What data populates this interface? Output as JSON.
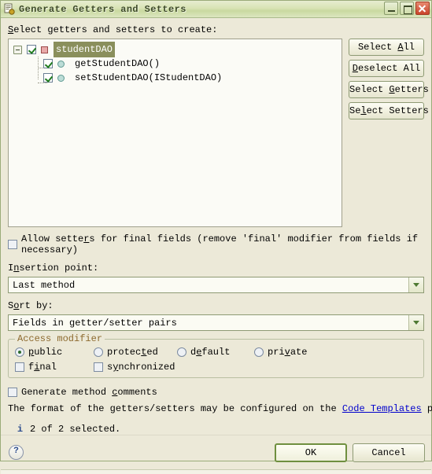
{
  "window": {
    "title": "Generate Getters and Setters",
    "app_icon": "generate-getters-setters-icon",
    "minimize_label": "Minimize",
    "maximize_label": "Maximize",
    "close_label": "Close"
  },
  "tree_section": {
    "label": "Select getters and setters to create:",
    "nodes": [
      {
        "label": "studentDAO",
        "icon": "field-icon",
        "checked": true,
        "selected": true,
        "expanded": true
      },
      {
        "label": "getStudentDAO()",
        "icon": "method-icon",
        "checked": true,
        "selected": false
      },
      {
        "label": "setStudentDAO(IStudentDAO)",
        "icon": "method-icon",
        "checked": true,
        "selected": false
      }
    ]
  },
  "side_buttons": [
    {
      "label": "Select All",
      "mnemonic_index": 7
    },
    {
      "label": "Deselect All",
      "mnemonic_index": 0
    },
    {
      "label": "Select Getters",
      "mnemonic_index": 7
    },
    {
      "label": "Select Setters",
      "mnemonic_index": 2
    }
  ],
  "allow_setters": {
    "label_pre": "Allow sette",
    "label_mnemonic": "r",
    "label_post": "s for final fields (remove 'final' modifier from fields if necessary)",
    "checked": false
  },
  "insertion_point": {
    "label_pre": "I",
    "label_mnemonic": "n",
    "label_post": "sertion point:",
    "value": "Last method",
    "arrow_icon": "chevron-down-icon"
  },
  "sort_by": {
    "label_pre": "S",
    "label_mnemonic": "o",
    "label_post": "rt by:",
    "value": "Fields in getter/setter pairs",
    "arrow_icon": "chevron-down-icon"
  },
  "access_modifier": {
    "legend": "Access modifier",
    "radios": [
      {
        "label_pre": "",
        "label_mnemonic": "p",
        "label_post": "ublic",
        "selected": true
      },
      {
        "label_pre": "protec",
        "label_mnemonic": "t",
        "label_post": "ed",
        "selected": false
      },
      {
        "label_pre": "d",
        "label_mnemonic": "e",
        "label_post": "fault",
        "selected": false
      },
      {
        "label_pre": "pri",
        "label_mnemonic": "v",
        "label_post": "ate",
        "selected": false
      }
    ],
    "checkboxes": [
      {
        "label_pre": "f",
        "label_mnemonic": "i",
        "label_post": "nal",
        "checked": false
      },
      {
        "label_pre": "s",
        "label_mnemonic": "y",
        "label_post": "nchronized",
        "checked": false
      }
    ]
  },
  "generate_comments": {
    "label_pre": "Generate method ",
    "label_mnemonic": "c",
    "label_post": "omments",
    "checked": false
  },
  "format_note": {
    "pre": "The format of the getters/setters may be configured on the ",
    "link": "Code Templates",
    "post": " preference page."
  },
  "status": {
    "icon": "info-icon",
    "text": "2 of 2 selected."
  },
  "footer": {
    "help_icon": "help-icon",
    "ok_label": "OK",
    "cancel_label": "Cancel"
  }
}
